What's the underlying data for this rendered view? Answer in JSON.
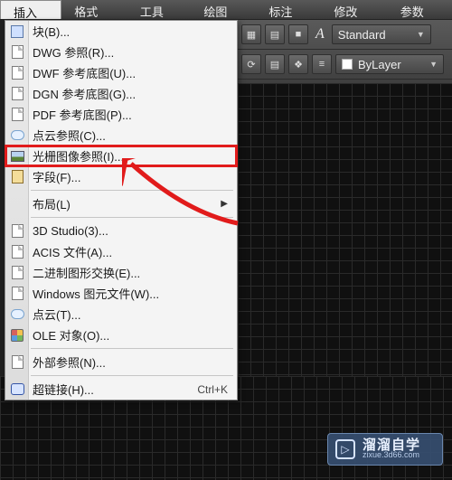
{
  "menubar": [
    {
      "label": "插入(I)",
      "active": true
    },
    {
      "label": "格式(O)"
    },
    {
      "label": "工具(T)"
    },
    {
      "label": "绘图(D)"
    },
    {
      "label": "标注(N)"
    },
    {
      "label": "修改(M)"
    },
    {
      "label": "参数(P)"
    }
  ],
  "dropdown": {
    "groups": [
      [
        {
          "label": "块(B)...",
          "icon": "block"
        },
        {
          "label": "DWG 参照(R)...",
          "icon": "doc"
        },
        {
          "label": "DWF 参考底图(U)...",
          "icon": "doc"
        },
        {
          "label": "DGN 参考底图(G)...",
          "icon": "doc"
        },
        {
          "label": "PDF 参考底图(P)...",
          "icon": "doc"
        },
        {
          "label": "点云参照(C)...",
          "icon": "cloud"
        },
        {
          "label": "光栅图像参照(I)...",
          "icon": "image",
          "highlight": true
        },
        {
          "label": "字段(F)...",
          "icon": "field"
        }
      ],
      [
        {
          "label": "布局(L)",
          "submenu": true
        }
      ],
      [
        {
          "label": "3D Studio(3)...",
          "icon": "doc"
        },
        {
          "label": "ACIS 文件(A)...",
          "icon": "doc"
        },
        {
          "label": "二进制图形交换(E)...",
          "icon": "doc"
        },
        {
          "label": "Windows 图元文件(W)...",
          "icon": "doc"
        },
        {
          "label": "点云(T)...",
          "icon": "cloud"
        },
        {
          "label": "OLE 对象(O)...",
          "icon": "ole"
        }
      ],
      [
        {
          "label": "外部参照(N)...",
          "icon": "doc"
        }
      ],
      [
        {
          "label": "超链接(H)...",
          "icon": "link",
          "shortcut": "Ctrl+K"
        }
      ]
    ]
  },
  "toolbar": {
    "style_label": "Standard",
    "layer_label": "ByLayer"
  },
  "badge": {
    "title": "溜溜自学",
    "sub": "zixue.3d66.com"
  }
}
